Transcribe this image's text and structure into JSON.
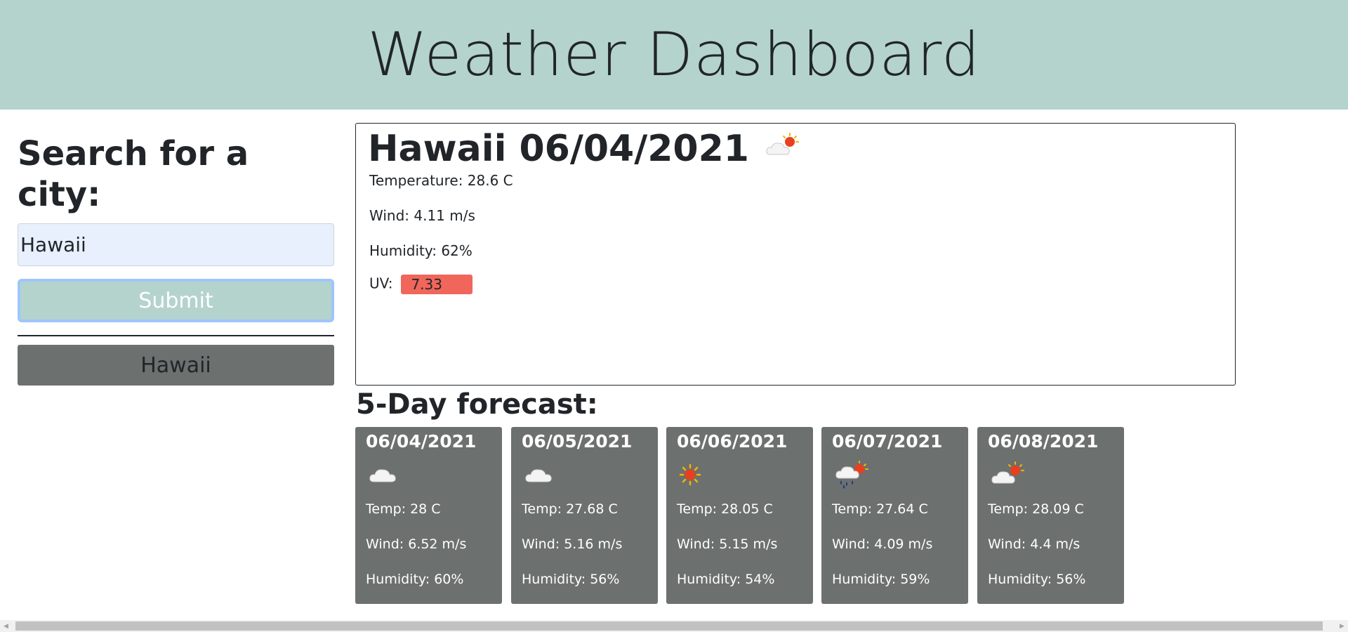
{
  "header": {
    "title": "Weather Dashboard"
  },
  "search": {
    "heading": "Search for a city:",
    "input_value": "Hawaii",
    "submit_label": "Submit",
    "history": [
      "Hawaii"
    ]
  },
  "current": {
    "title": "Hawaii 06/04/2021",
    "icon": "few-clouds-day-icon",
    "temperature": "Temperature: 28.6 C",
    "wind": "Wind: 4.11 m/s",
    "humidity": "Humidity: 62%",
    "uv_label": "UV:",
    "uv_value": "7.33",
    "uv_color": "#f0665a"
  },
  "forecast": {
    "title": "5-Day forecast:",
    "days": [
      {
        "date": "06/04/2021",
        "icon": "cloud-icon",
        "temp": "Temp: 28 C",
        "wind": "Wind: 6.52 m/s",
        "humidity": "Humidity: 60%"
      },
      {
        "date": "06/05/2021",
        "icon": "cloud-icon",
        "temp": "Temp: 27.68 C",
        "wind": "Wind: 5.16 m/s",
        "humidity": "Humidity: 56%"
      },
      {
        "date": "06/06/2021",
        "icon": "sun-icon",
        "temp": "Temp: 28.05 C",
        "wind": "Wind: 5.15 m/s",
        "humidity": "Humidity: 54%"
      },
      {
        "date": "06/07/2021",
        "icon": "rain-sun-icon",
        "temp": "Temp: 27.64 C",
        "wind": "Wind: 4.09 m/s",
        "humidity": "Humidity: 59%"
      },
      {
        "date": "06/08/2021",
        "icon": "few-clouds-day-icon",
        "temp": "Temp: 28.09 C",
        "wind": "Wind: 4.4 m/s",
        "humidity": "Humidity: 56%"
      }
    ]
  },
  "colors": {
    "accent": "#b4d3cc",
    "card": "#6c706e",
    "uv_high": "#f0665a"
  }
}
